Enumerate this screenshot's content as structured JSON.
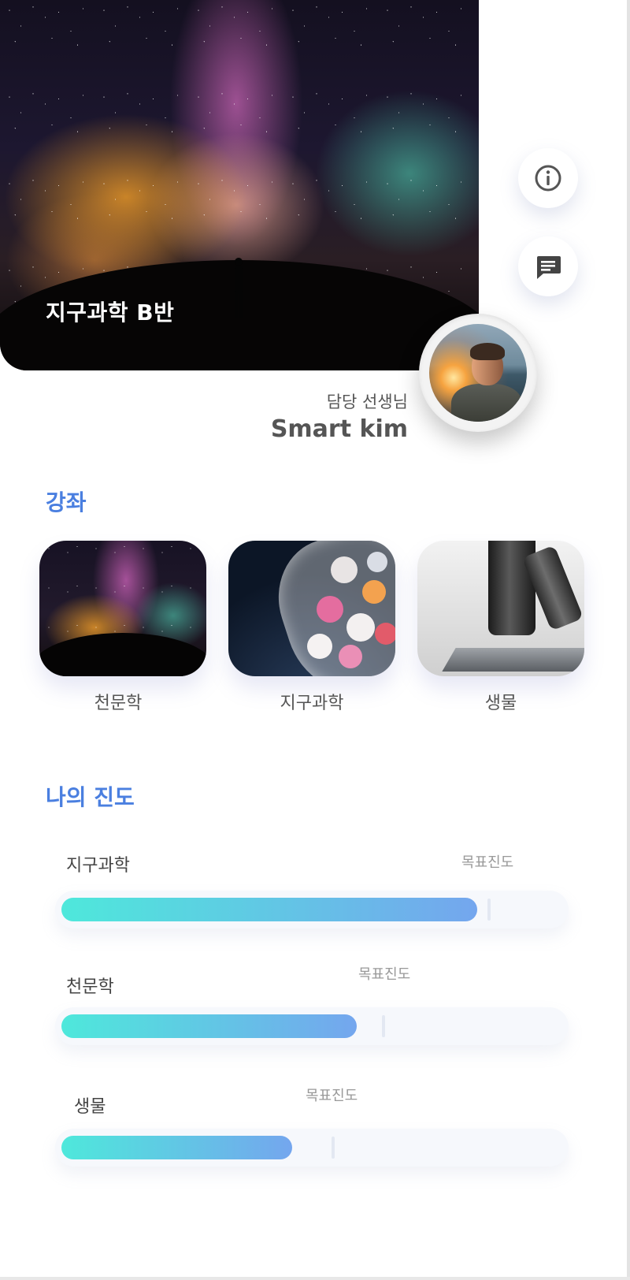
{
  "hero": {
    "title": "지구과학 B반"
  },
  "actions": {
    "info_icon": "info-icon",
    "message_icon": "message-icon"
  },
  "teacher": {
    "label": "담당 선생님",
    "name": "Smart kim"
  },
  "courses": {
    "title": "강좌",
    "items": [
      {
        "label": "천문학"
      },
      {
        "label": "지구과학"
      },
      {
        "label": "생물"
      }
    ]
  },
  "progress": {
    "title": "나의 진도",
    "goal_label": "목표진도",
    "items": [
      {
        "name": "지구과학",
        "value": 0.83,
        "goal": 0.85
      },
      {
        "name": "천문학",
        "value": 0.59,
        "goal": 0.64
      },
      {
        "name": "생물",
        "value": 0.46,
        "goal": 0.54
      }
    ]
  },
  "colors": {
    "accent": "#4a7fe0",
    "progress_start": "#4ee8db",
    "progress_end": "#74a6ee"
  }
}
